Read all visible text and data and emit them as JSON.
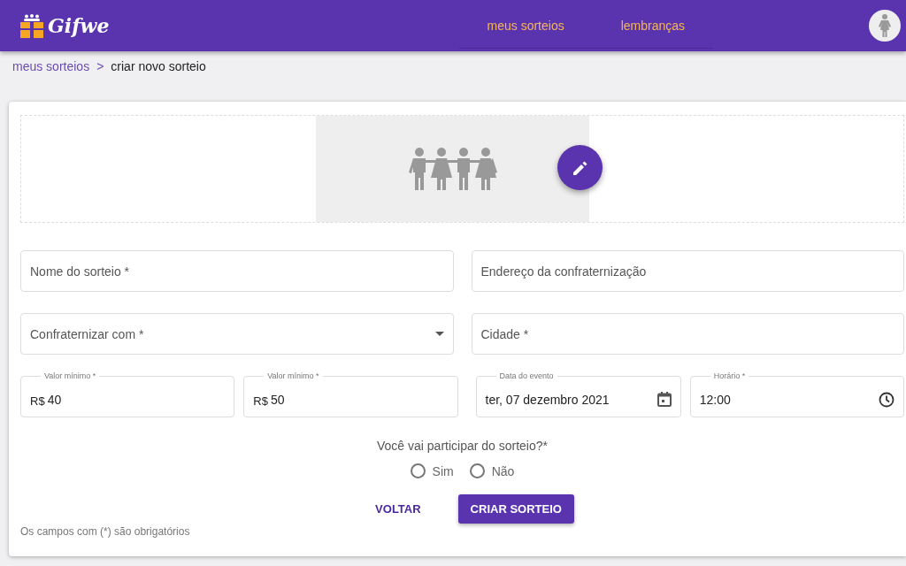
{
  "header": {
    "logo": "Gifwe",
    "nav": [
      {
        "label": "meus sorteios"
      },
      {
        "label": "lembranças"
      }
    ]
  },
  "breadcrumb": {
    "parent": "meus sorteios",
    "separator": ">",
    "current": "criar novo sorteio"
  },
  "form": {
    "rows": [
      [
        {
          "kind": "text",
          "placeholder": "Nome do sorteio *"
        },
        {
          "kind": "text",
          "placeholder": "Endereço da confraternização"
        }
      ],
      [
        {
          "kind": "select",
          "placeholder": "Confraternizar com *"
        },
        {
          "kind": "text",
          "placeholder": "Cidade *"
        }
      ],
      [
        {
          "kind": "money",
          "label": "Valor mínimo *",
          "prefix": "R$",
          "value": "40"
        },
        {
          "kind": "money",
          "label": "Valor mínimo *",
          "prefix": "R$",
          "value": "50"
        },
        {
          "kind": "date",
          "label": "Data do evento",
          "value": "ter, 07 dezembro 2021"
        },
        {
          "kind": "time",
          "label": "Horário *",
          "value": "12:00"
        }
      ]
    ],
    "question": "Você vai participar do sorteio?*",
    "options": [
      {
        "label": "Sim",
        "selected": false
      },
      {
        "label": "Não",
        "selected": false
      }
    ],
    "buttons": [
      {
        "label": "VOLTAR",
        "kind": "text"
      },
      {
        "label": "CRIAR SORTEIO",
        "kind": "primary"
      }
    ],
    "note": "Os campos com (*) são obrigatórios"
  }
}
